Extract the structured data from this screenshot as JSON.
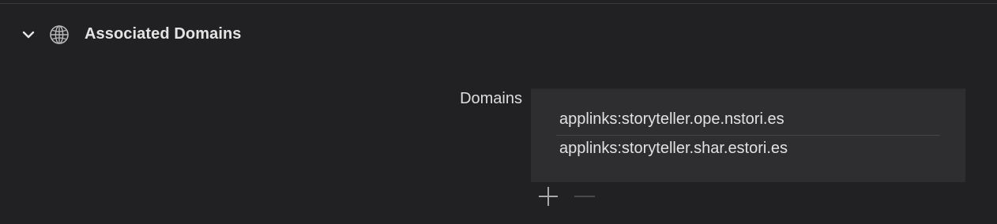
{
  "section": {
    "title": "Associated Domains",
    "expanded": true,
    "icon": "globe-icon",
    "chevron_icon": "chevron-down-icon"
  },
  "domains": {
    "label": "Domains",
    "entries": [
      "applinks:storyteller.ope.nstori.es",
      "applinks:storyteller.shar.estori.es"
    ],
    "add_icon": "plus-icon",
    "remove_icon": "minus-icon",
    "remove_enabled": false
  },
  "colors": {
    "background": "#212123",
    "table_background": "#2e2e30",
    "text": "#e2e2e2",
    "disabled_control": "#4a4a4d"
  }
}
